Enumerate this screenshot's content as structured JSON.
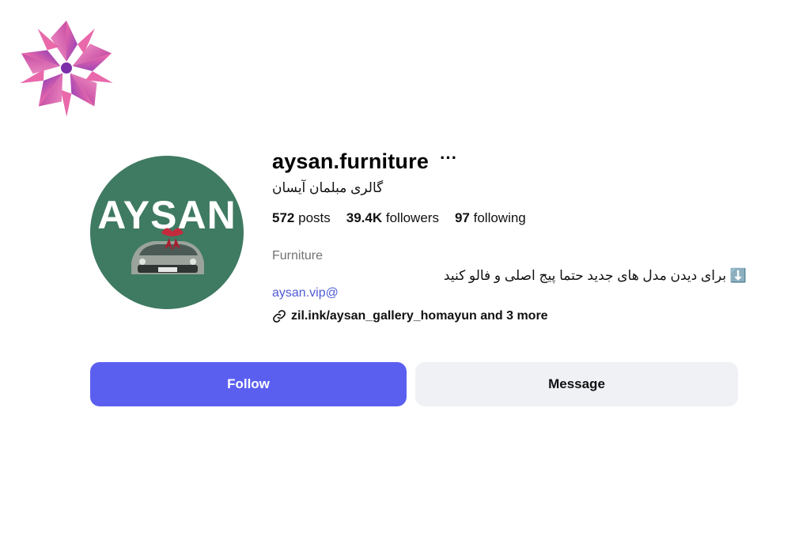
{
  "profile": {
    "username": "aysan.furniture",
    "full_name": "گالری مبلمان آیسان",
    "more_glyph": "···",
    "avatar_text": "AYSAN"
  },
  "stats": {
    "posts_count": "572",
    "posts_label": "posts",
    "followers_count": "39.4K",
    "followers_label": "followers",
    "following_count": "97",
    "following_label": "following"
  },
  "bio": {
    "category": "Furniture",
    "line": "⬇️ برای دیدن مدل های جدید حتما پیج اصلی و فالو کنید",
    "handle": "aysan.vip@",
    "link_text": "zil.ink/aysan_gallery_homayun and 3 more"
  },
  "actions": {
    "follow_label": "Follow",
    "message_label": "Message"
  },
  "colors": {
    "follow_button": "#5b5ff0",
    "message_button": "#eff1f5",
    "avatar_background": "#3f7a62",
    "link": "#4f5bd5",
    "category_text": "#737373"
  },
  "icons": {
    "logo": "pink-purple-pinwheel-logo-icon",
    "more": "ellipsis-icon",
    "link": "chain-link-icon"
  }
}
